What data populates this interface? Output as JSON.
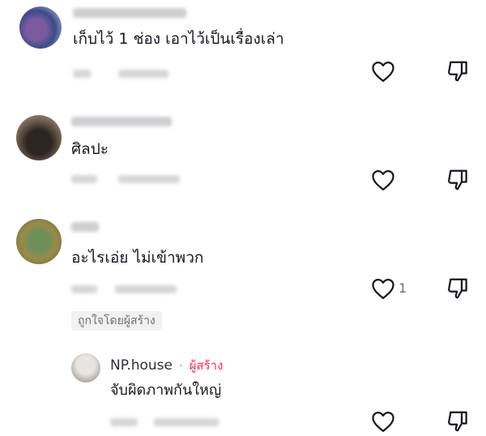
{
  "colors": {
    "accent": "#fe2c55",
    "text": "#161823",
    "muted": "#6f6f75",
    "badge_bg": "#f1f1f2"
  },
  "comments": [
    {
      "text": "เก็บไว้ 1 ช่อง เอาไว้เป็นเรื่องเล่า",
      "like_count": ""
    },
    {
      "text": "ศิลปะ",
      "like_count": ""
    },
    {
      "text": "อะไรเอ่ย ไม่เข้าพวก",
      "like_count": "1",
      "liked_by_creator_label": "ถูกใจโดยผู้สร้าง"
    }
  ],
  "reply": {
    "author": "NP.house",
    "separator": "·",
    "creator_label": "ผู้สร้าง",
    "text": "จับผิดภาพกันใหญ่",
    "like_count": ""
  },
  "icons": {
    "like": "heart-outline-icon",
    "dislike": "thumbs-down-outline-icon"
  }
}
